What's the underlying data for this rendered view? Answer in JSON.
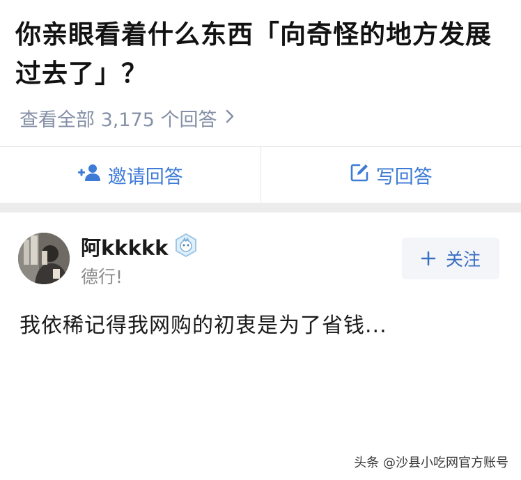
{
  "question": {
    "title": "你亲眼看着什么东西「向奇怪的地方发展过去了」？",
    "view_all": "查看全部 3,175 个回答",
    "view_all_chevron": "chevron-right-icon"
  },
  "actions": {
    "invite_label": "邀请回答",
    "invite_icon": "add-user-icon",
    "write_label": "写回答",
    "write_icon": "edit-icon"
  },
  "answer": {
    "author_name": "阿kkkkk",
    "author_bio": "德行!",
    "follow_label": "关注",
    "text": "我依稀记得我网购的初衷是为了省钱..."
  },
  "watermark": "头条 @沙县小吃网官方账号",
  "colors": {
    "accent": "#3d7bd6",
    "muted": "#8590a6",
    "divider": "#e6e6e6"
  }
}
